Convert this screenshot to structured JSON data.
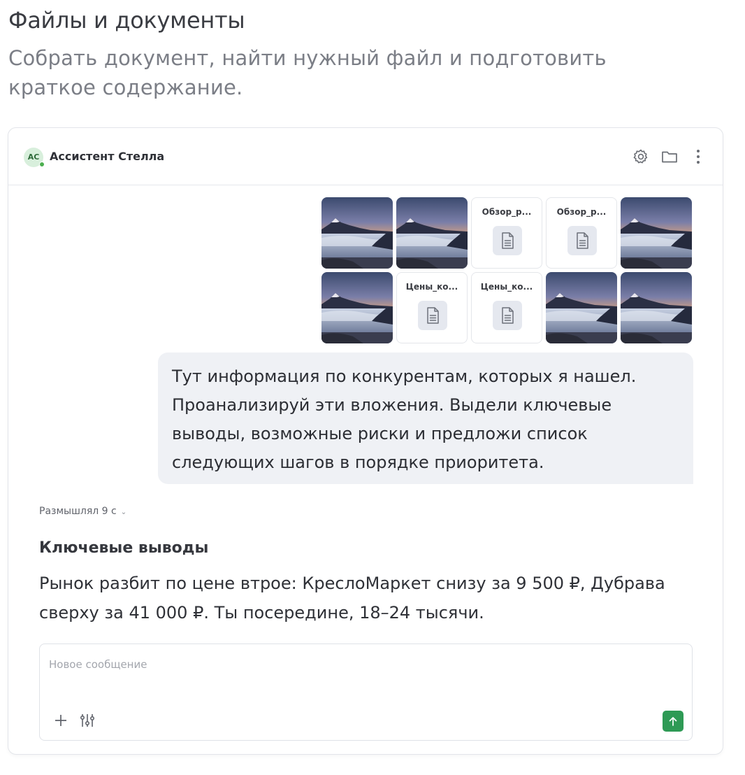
{
  "page": {
    "title": "Файлы и документы",
    "subtitle": "Собрать документ, найти нужный файл и подготовить краткое содержание."
  },
  "header": {
    "avatar_initials": "АС",
    "assistant_name": "Ассистент Стелла",
    "icons": [
      "gear-icon",
      "folder-icon",
      "more-vertical-icon"
    ]
  },
  "attachments": [
    {
      "kind": "image",
      "icon": "mountain-photo"
    },
    {
      "kind": "image",
      "icon": "mountain-photo"
    },
    {
      "kind": "document",
      "name": "Обзор_р...",
      "icon": "document-icon"
    },
    {
      "kind": "document",
      "name": "Обзор_р...",
      "icon": "document-icon"
    },
    {
      "kind": "image",
      "icon": "mountain-photo"
    },
    {
      "kind": "image",
      "icon": "mountain-photo"
    },
    {
      "kind": "document",
      "name": "Цены_ко...",
      "icon": "document-icon"
    },
    {
      "kind": "document",
      "name": "Цены_ко...",
      "icon": "document-icon"
    },
    {
      "kind": "image",
      "icon": "mountain-photo"
    },
    {
      "kind": "image",
      "icon": "mountain-photo"
    }
  ],
  "user_message": "Тут информация по конкурентам, которых я нашел. Проанализируй эти вложения. Выдели ключевые выводы, возможные риски и предложи список следующих шагов в порядке приоритета.",
  "assistant": {
    "thinking_label": "Размышлял 9 с",
    "heading": "Ключевые выводы",
    "text": "Рынок разбит по цене втрое: КреслоМаркет снизу за 9 500 ₽, Дубрава сверху за 41 000 ₽. Ты посередине, 18–24 тысячи."
  },
  "composer": {
    "placeholder": "Новое сообщение",
    "value": ""
  },
  "colors": {
    "accent": "#2e9a55",
    "bubble": "#eff1f5",
    "avatar_bg": "#d8efdc"
  }
}
